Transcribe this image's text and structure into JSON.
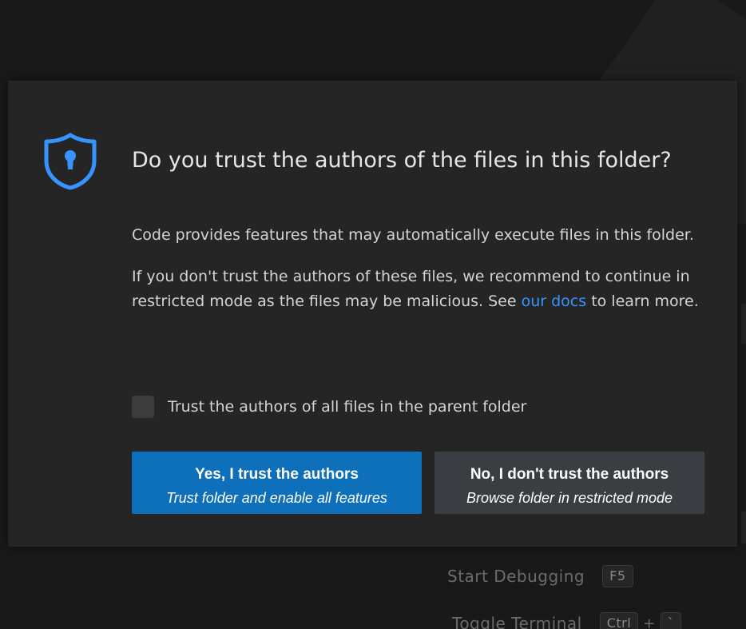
{
  "dialog": {
    "title": "Do you trust the authors of the files in this folder?",
    "paragraph1": "Code provides features that may automatically execute files in this folder.",
    "paragraph2_before_link": "If you don't trust the authors of these files, we recommend to continue in restricted mode as the files may be malicious. See ",
    "paragraph2_link": "our docs",
    "paragraph2_after_link": " to learn more.",
    "checkbox_label": "Trust the authors of all files in the parent folder",
    "checkbox_checked": false,
    "trust_button": {
      "label": "Yes, I trust the authors",
      "sublabel": "Trust folder and enable all features"
    },
    "distrust_button": {
      "label": "No, I don't trust the authors",
      "sublabel": "Browse folder in restricted mode"
    }
  },
  "background_hints": [
    {
      "label": "Start Debugging",
      "keys": [
        "F5"
      ]
    },
    {
      "label": "Toggle Terminal",
      "keys": [
        "Ctrl",
        "`"
      ]
    }
  ],
  "background_hint_plus": "+",
  "colors": {
    "accent_link": "#3794ff",
    "primary_button": "#0e6fba",
    "secondary_button": "#3a3d41",
    "dialog_bg": "#252526",
    "shield_icon": "#3794ff"
  }
}
